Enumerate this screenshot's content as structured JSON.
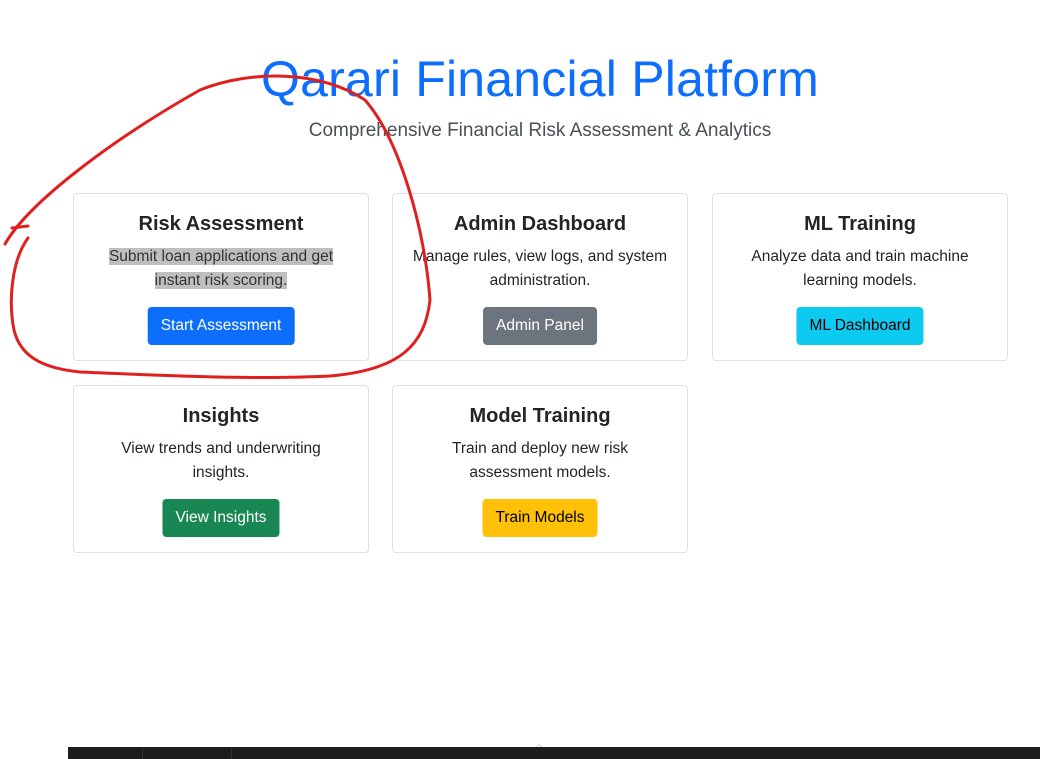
{
  "header": {
    "title": "Qarari Financial Platform",
    "subtitle": "Comprehensive Financial Risk Assessment & Analytics"
  },
  "cards": [
    {
      "title": "Risk Assessment",
      "description_line1": "Submit loan applications and get",
      "description_line2": "instant risk scoring.",
      "button_label": "Start Assessment",
      "button_color": "#0d6efd"
    },
    {
      "title": "Admin Dashboard",
      "description_line1": "Manage rules, view logs, and system",
      "description_line2": "administration.",
      "button_label": "Admin Panel",
      "button_color": "#6c757d"
    },
    {
      "title": "ML Training",
      "description_line1": "Analyze data and train machine",
      "description_line2": "learning models.",
      "button_label": "ML Dashboard",
      "button_color": "#0dcaf0"
    },
    {
      "title": "Insights",
      "description_line1": "View trends and underwriting",
      "description_line2": "insights.",
      "button_label": "View Insights",
      "button_color": "#198754"
    },
    {
      "title": "Model Training",
      "description_line1": "Train and deploy new risk",
      "description_line2": "assessment models.",
      "button_label": "Train Models",
      "button_color": "#ffc107"
    }
  ],
  "annotation": {
    "color": "#e02020",
    "icon": "hand-drawn-circle"
  },
  "taskbar": {
    "icon": "chevron-up-icon"
  }
}
